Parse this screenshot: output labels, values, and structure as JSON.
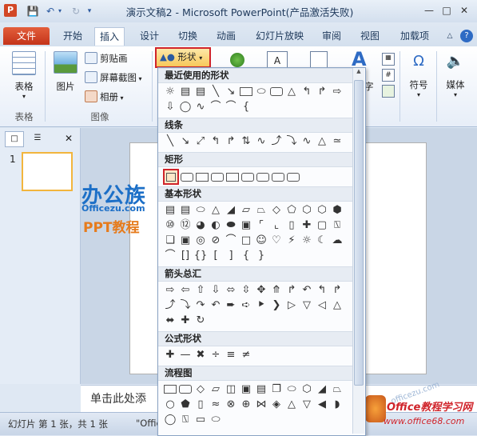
{
  "window": {
    "title": "演示文稿2 - Microsoft PowerPoint(产品激活失败)",
    "app_icon": "P"
  },
  "tabs": [
    "文件",
    "开始",
    "插入",
    "设计",
    "切换",
    "动画",
    "幻灯片放映",
    "审阅",
    "视图",
    "加载项"
  ],
  "ribbon": {
    "table_label": "表格",
    "table_group": "表格",
    "picture_label": "图片",
    "clipart": "剪贴画",
    "screenshot": "屏幕截图",
    "album": "相册",
    "image_group": "图像",
    "shapes_btn": "形状",
    "symbol_label": "符号",
    "media_label": "媒体",
    "wordart_partial": "字"
  },
  "shapes_panel": {
    "recent": "最近使用的形状",
    "lines": "线条",
    "rect": "矩形",
    "basic": "基本形状",
    "arrows": "箭头总汇",
    "equation": "公式形状",
    "flowchart": "流程图"
  },
  "slide_panel": {
    "slide_number": "1"
  },
  "notes_placeholder": "单击此处添",
  "status": {
    "slide_info": "幻灯片 第 1 张，共 1 张",
    "theme_partial": "\"Offic"
  },
  "watermark": {
    "logo_main": "办公族",
    "logo_sub": "Officezu.com",
    "logo_ppt": "PPT教程",
    "site_main": "Office教程学习网",
    "site_url": "www.office68.com",
    "faint_url": "officezu.com"
  },
  "colors": {
    "accent_red": "#d0242b",
    "file_tab": "#c4341a",
    "logo_blue": "#1c6fc7",
    "logo_orange": "#e67b1c"
  }
}
